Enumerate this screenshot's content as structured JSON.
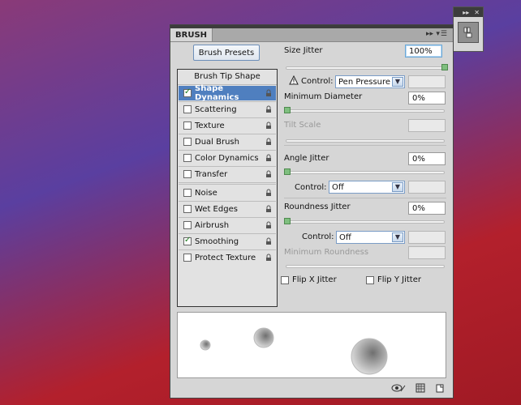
{
  "panel": {
    "tab_title": "BRUSH",
    "brush_presets_button": "Brush Presets",
    "left": {
      "header": "Brush Tip Shape",
      "items": [
        {
          "label": "Shape Dynamics",
          "checked": true
        },
        {
          "label": "Scattering",
          "checked": false
        },
        {
          "label": "Texture",
          "checked": false
        },
        {
          "label": "Dual Brush",
          "checked": false
        },
        {
          "label": "Color Dynamics",
          "checked": false
        },
        {
          "label": "Transfer",
          "checked": false
        },
        {
          "label": "Noise",
          "checked": false
        },
        {
          "label": "Wet Edges",
          "checked": false
        },
        {
          "label": "Airbrush",
          "checked": false
        },
        {
          "label": "Smoothing",
          "checked": true
        },
        {
          "label": "Protect Texture",
          "checked": false
        }
      ]
    },
    "right": {
      "size_jitter": {
        "label": "Size Jitter",
        "value": "100%"
      },
      "control1": {
        "label": "Control:",
        "value": "Pen Pressure"
      },
      "min_diameter": {
        "label": "Minimum Diameter",
        "value": "0%"
      },
      "tilt_scale": {
        "label": "Tilt Scale"
      },
      "angle_jitter": {
        "label": "Angle Jitter",
        "value": "0%"
      },
      "control2": {
        "label": "Control:",
        "value": "Off"
      },
      "roundness_jitter": {
        "label": "Roundness Jitter",
        "value": "0%"
      },
      "control3": {
        "label": "Control:",
        "value": "Off"
      },
      "min_roundness": {
        "label": "Minimum Roundness"
      },
      "flip_x": {
        "label": "Flip X Jitter"
      },
      "flip_y": {
        "label": "Flip Y Jitter"
      }
    }
  }
}
